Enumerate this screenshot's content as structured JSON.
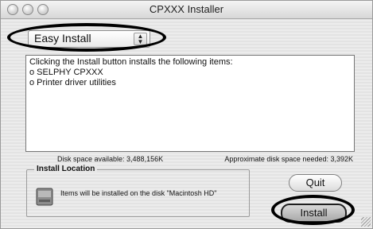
{
  "window": {
    "title": "CPXXX  Installer"
  },
  "popup": {
    "selected": "Easy Install",
    "arrows": "▲▼"
  },
  "list": {
    "lines": [
      "Clicking the Install button installs the following items:",
      "o SELPHY CPXXX",
      "o Printer driver utilities"
    ]
  },
  "disk": {
    "available": "Disk space available: 3,488,156K",
    "needed": "Approximate disk space needed: 3,392K"
  },
  "install_location": {
    "title": "Install Location",
    "text": "Items will be installed on the disk \"Macintosh HD\"",
    "icon": "hard-disk-icon"
  },
  "buttons": {
    "quit": "Quit",
    "install": "Install"
  }
}
